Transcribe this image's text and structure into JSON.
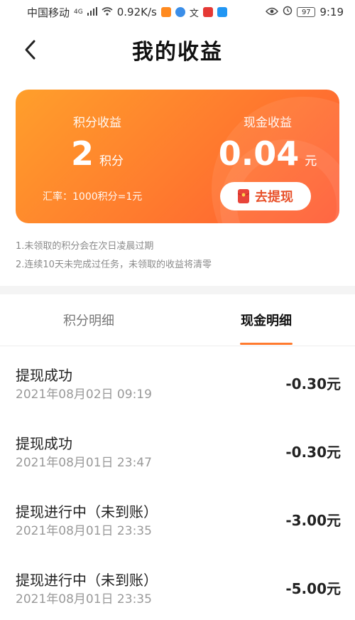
{
  "statusbar": {
    "carrier": "中国移动",
    "network": "4G",
    "speed": "0.92K/s",
    "battery": "97",
    "time": "9:19"
  },
  "header": {
    "title": "我的收益"
  },
  "earnings": {
    "points_label": "积分收益",
    "points_value": "2",
    "points_unit": "积分",
    "cash_label": "现金收益",
    "cash_value": "0.04",
    "cash_unit": "元",
    "rate": "汇率：1000积分=1元",
    "withdraw_label": "去提现"
  },
  "notes": [
    "1.未领取的积分会在次日凌晨过期",
    "2.连续10天未完成过任务，未领取的收益将清零"
  ],
  "tabs": [
    {
      "label": "积分明细",
      "active": false
    },
    {
      "label": "现金明细",
      "active": true
    }
  ],
  "records": [
    {
      "title": "提现成功",
      "time": "2021年08月02日 09:19",
      "amount": "-0.30元"
    },
    {
      "title": "提现成功",
      "time": "2021年08月01日 23:47",
      "amount": "-0.30元"
    },
    {
      "title": "提现进行中（未到账）",
      "time": "2021年08月01日 23:35",
      "amount": "-3.00元"
    },
    {
      "title": "提现进行中（未到账）",
      "time": "2021年08月01日 23:35",
      "amount": "-5.00元"
    }
  ],
  "colors": {
    "accent": "#ff7a2e",
    "accent_dark": "#e8512a"
  }
}
